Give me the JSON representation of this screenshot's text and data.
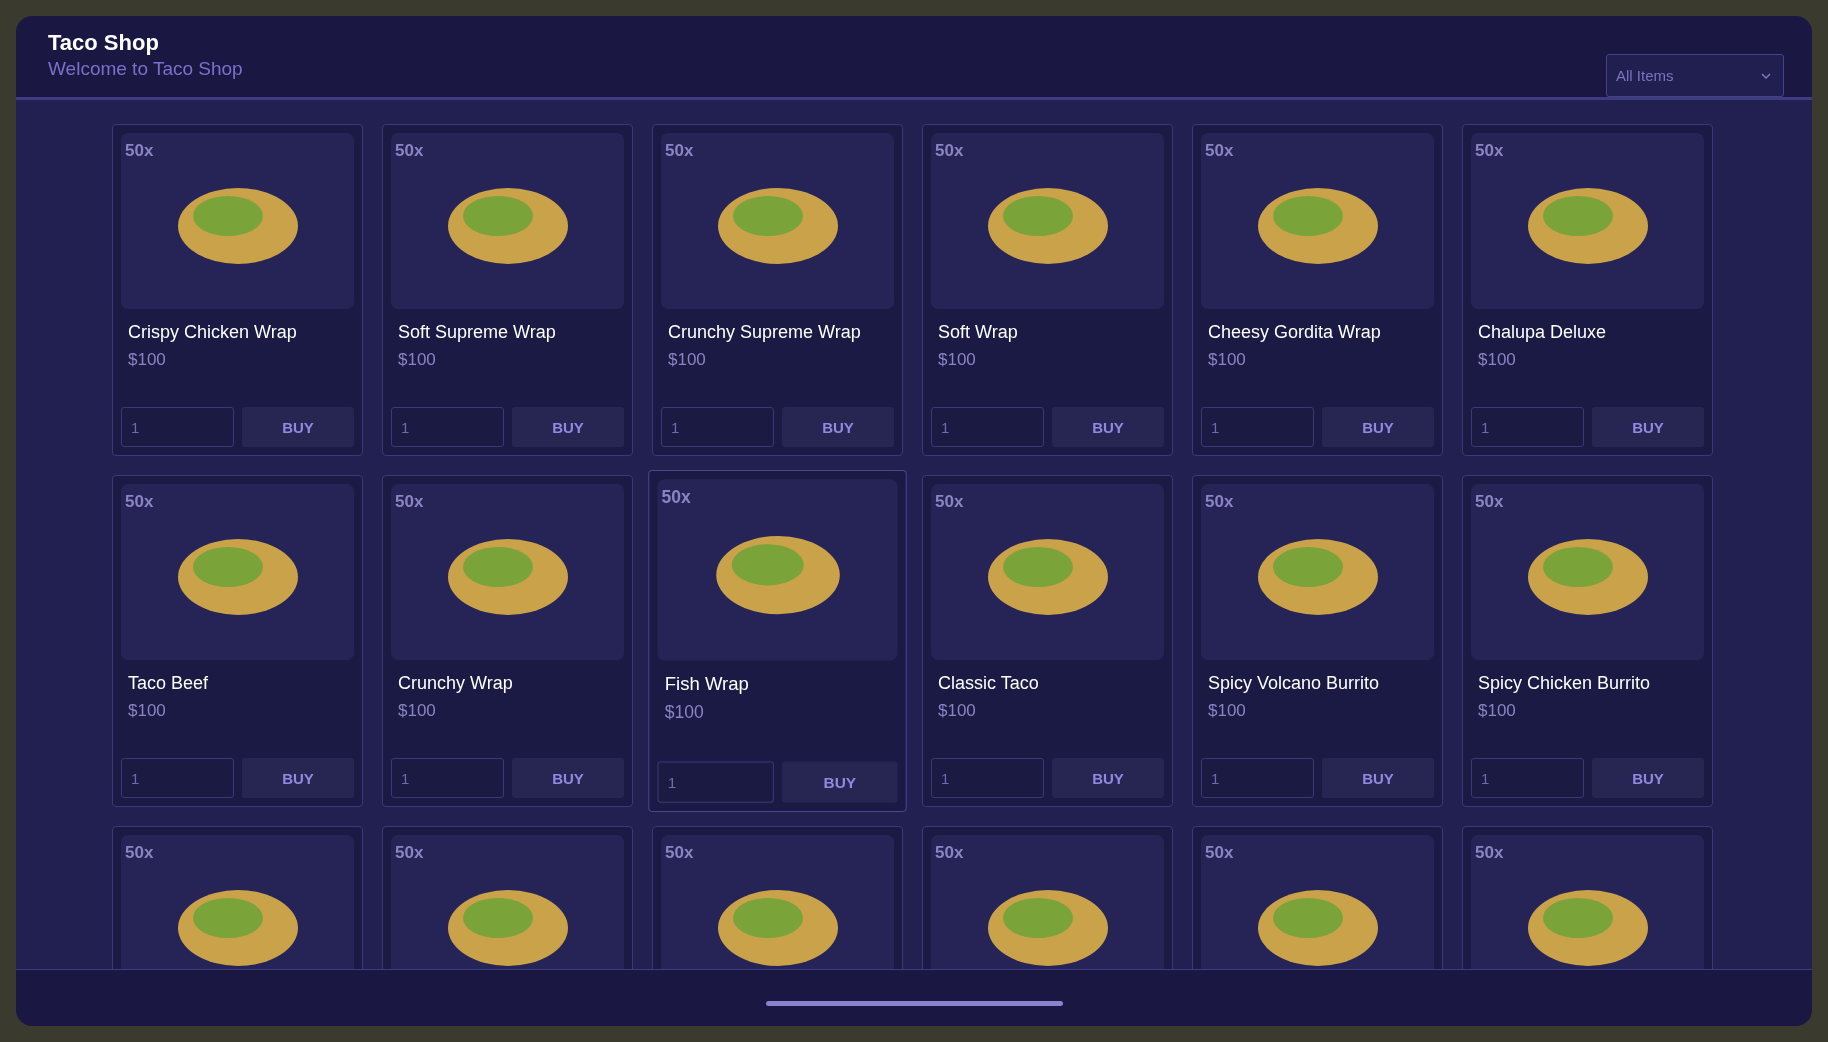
{
  "header": {
    "title": "Taco Shop",
    "subtitle": "Welcome to Taco Shop"
  },
  "filter": {
    "value": "All Items"
  },
  "items": [
    {
      "stock": "50x",
      "name": "Crispy Chicken Wrap",
      "price": "$100",
      "quantity": "1",
      "action": "BUY",
      "hovered": false
    },
    {
      "stock": "50x",
      "name": "Soft Supreme Wrap",
      "price": "$100",
      "quantity": "1",
      "action": "BUY",
      "hovered": false
    },
    {
      "stock": "50x",
      "name": "Crunchy Supreme Wrap",
      "price": "$100",
      "quantity": "1",
      "action": "BUY",
      "hovered": false
    },
    {
      "stock": "50x",
      "name": "Soft Wrap",
      "price": "$100",
      "quantity": "1",
      "action": "BUY",
      "hovered": false
    },
    {
      "stock": "50x",
      "name": "Cheesy Gordita Wrap",
      "price": "$100",
      "quantity": "1",
      "action": "BUY",
      "hovered": false
    },
    {
      "stock": "50x",
      "name": "Chalupa Deluxe",
      "price": "$100",
      "quantity": "1",
      "action": "BUY",
      "hovered": false
    },
    {
      "stock": "50x",
      "name": "Taco Beef",
      "price": "$100",
      "quantity": "1",
      "action": "BUY",
      "hovered": false
    },
    {
      "stock": "50x",
      "name": "Crunchy Wrap",
      "price": "$100",
      "quantity": "1",
      "action": "BUY",
      "hovered": false
    },
    {
      "stock": "50x",
      "name": "Fish Wrap",
      "price": "$100",
      "quantity": "1",
      "action": "BUY",
      "hovered": true
    },
    {
      "stock": "50x",
      "name": "Classic Taco",
      "price": "$100",
      "quantity": "1",
      "action": "BUY",
      "hovered": false
    },
    {
      "stock": "50x",
      "name": "Spicy Volcano Burrito",
      "price": "$100",
      "quantity": "1",
      "action": "BUY",
      "hovered": false
    },
    {
      "stock": "50x",
      "name": "Spicy Chicken Burrito",
      "price": "$100",
      "quantity": "1",
      "action": "BUY",
      "hovered": false
    },
    {
      "stock": "50x",
      "hovered": false
    },
    {
      "stock": "50x",
      "hovered": false
    },
    {
      "stock": "50x",
      "hovered": false
    },
    {
      "stock": "50x",
      "hovered": false
    },
    {
      "stock": "50x",
      "hovered": false
    },
    {
      "stock": "50x",
      "hovered": false
    }
  ]
}
